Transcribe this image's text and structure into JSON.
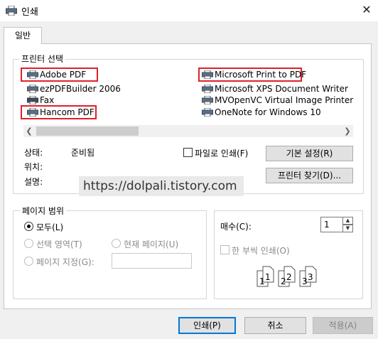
{
  "window": {
    "title": "인쇄",
    "close_glyph": "✕"
  },
  "tab": {
    "general": "일반"
  },
  "printer_select": {
    "title": "프린터 선택",
    "left_column": [
      "Adobe PDF",
      "ezPDFBuilder 2006",
      "Fax",
      "Hancom PDF"
    ],
    "right_column": [
      "Microsoft Print to PDF",
      "Microsoft XPS Document Writer",
      "MVOpenVC Virtual Image Printer",
      "OneNote for Windows 10"
    ],
    "highlight_color": "#e0202c",
    "status_label": "상태:",
    "status_value": "준비됨",
    "location_label": "위치:",
    "comment_label": "설명:",
    "print_to_file": "파일로 인쇄(F)",
    "preferences_button": "기본 설정(R)",
    "find_printer_button": "프린터 찾기(D)..."
  },
  "watermark": "https://dolpali.tistory.com",
  "page_range": {
    "title": "페이지 범위",
    "all": "모두(L)",
    "selection": "선택 영역(T)",
    "current_page": "현재 페이지(U)",
    "pages": "페이지 지정(G):"
  },
  "copies": {
    "label": "매수(C):",
    "value": "1",
    "collate": "한 부씩 인쇄(O)",
    "collate_page_numbers": [
      "1",
      "1",
      "2",
      "2",
      "3",
      "3"
    ]
  },
  "buttons": {
    "print": "인쇄(P)",
    "cancel": "취소",
    "apply": "적용(A)"
  }
}
